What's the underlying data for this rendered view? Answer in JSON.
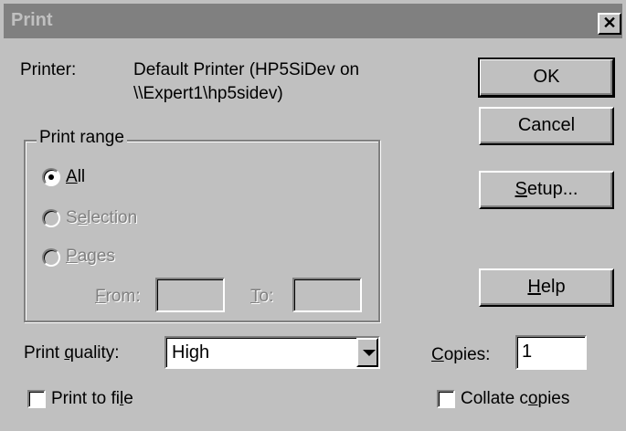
{
  "window": {
    "title": "Print",
    "close_glyph": "✕"
  },
  "printer": {
    "label": "Printer:",
    "name_line1": "Default Printer (HP5SiDev on",
    "name_line2": "\\\\Expert1\\hp5sidev)"
  },
  "buttons": {
    "ok": "OK",
    "cancel": "Cancel",
    "setup_u": "S",
    "setup_rest": "etup...",
    "help_u": "H",
    "help_rest": "elp"
  },
  "print_range": {
    "label": "Print range",
    "all_u": "A",
    "all_rest": "ll",
    "selection_pre": "S",
    "selection_u": "e",
    "selection_rest": "lection",
    "pages_u": "P",
    "pages_rest": "ages",
    "from_u": "F",
    "from_rest": "rom:",
    "to_u": "T",
    "to_rest": "o:",
    "from_value": "",
    "to_value": ""
  },
  "quality": {
    "label_pre": "Print ",
    "label_u": "q",
    "label_rest": "uality:",
    "value": "High"
  },
  "copies": {
    "label_u": "C",
    "label_rest": "opies:",
    "value": "1"
  },
  "print_to_file": {
    "label_pre": "Print to fi",
    "label_u": "l",
    "label_rest": "e"
  },
  "collate": {
    "label_pre": "Collate c",
    "label_u": "o",
    "label_rest": "pies"
  },
  "icons": {
    "close": "close-icon",
    "dropdown": "chevron-down-icon",
    "radio_selected": "radio-selected-icon"
  },
  "colors": {
    "face": "#c0c0c0",
    "titlebar": "#808080",
    "disabled_text": "#808080"
  }
}
